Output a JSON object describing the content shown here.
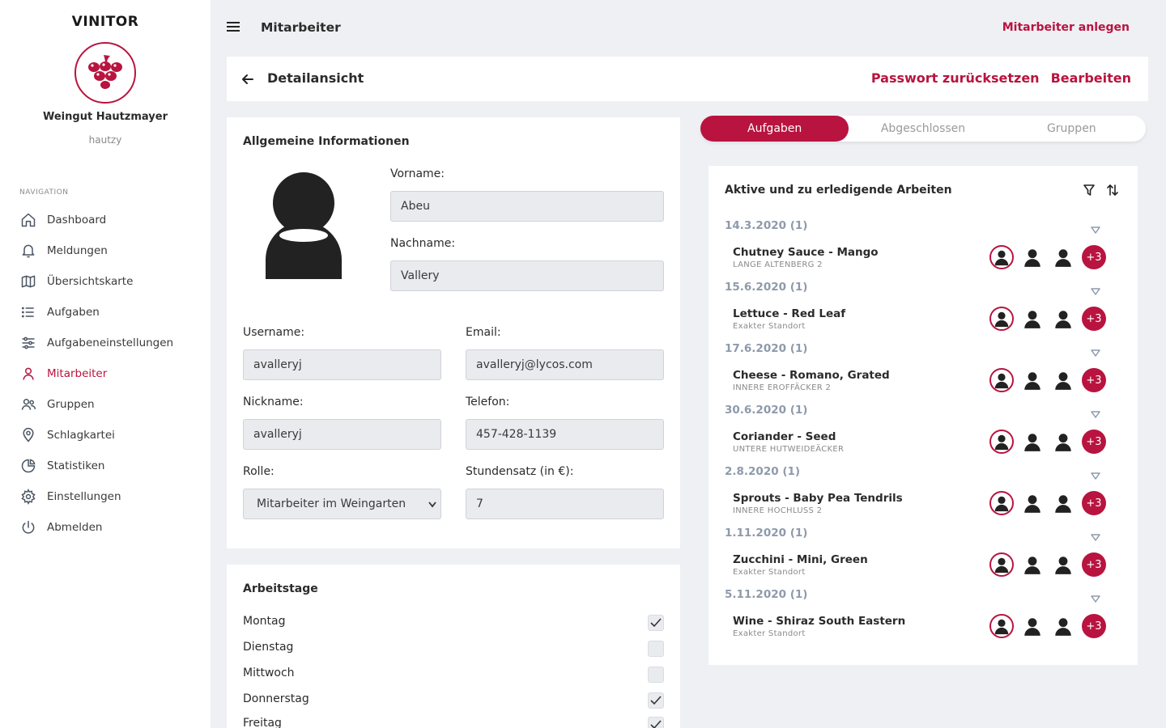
{
  "app": {
    "brand": "VINITOR",
    "org_name": "Weingut Hautzmayer",
    "org_user": "hautzy"
  },
  "colors": {
    "accent": "#b8143f",
    "background": "#eef0f4",
    "muted_date": "#8e9aab"
  },
  "sidebar": {
    "heading": "NAVIGATION",
    "items": [
      {
        "label": "Dashboard",
        "icon": "home-icon"
      },
      {
        "label": "Meldungen",
        "icon": "bell-icon"
      },
      {
        "label": "Übersichtskarte",
        "icon": "map-icon"
      },
      {
        "label": "Aufgaben",
        "icon": "list-icon"
      },
      {
        "label": "Aufgabeneinstellungen",
        "icon": "sliders-icon"
      },
      {
        "label": "Mitarbeiter",
        "icon": "user-icon",
        "active": true
      },
      {
        "label": "Gruppen",
        "icon": "users-icon"
      },
      {
        "label": "Schlagkartei",
        "icon": "map-pin-icon"
      },
      {
        "label": "Statistiken",
        "icon": "pie-chart-icon"
      },
      {
        "label": "Einstellungen",
        "icon": "gear-icon"
      },
      {
        "label": "Abmelden",
        "icon": "power-icon"
      }
    ]
  },
  "header": {
    "title": "Mitarbeiter",
    "create_label": "Mitarbeiter anlegen"
  },
  "detail": {
    "title": "Detailansicht",
    "reset_password_label": "Passwort zurücksetzen",
    "edit_label": "Bearbeiten"
  },
  "info": {
    "title": "Allgemeine Informationen",
    "firstname_label": "Vorname:",
    "firstname": "Abeu",
    "lastname_label": "Nachname:",
    "lastname": "Vallery",
    "username_label": "Username:",
    "username": "avalleryj",
    "email_label": "Email:",
    "email": "avalleryj@lycos.com",
    "nickname_label": "Nickname:",
    "nickname": "avalleryj",
    "phone_label": "Telefon:",
    "phone": "457-428-1139",
    "role_label": "Rolle:",
    "role": "Mitarbeiter im Weingarten",
    "rate_label": "Stundensatz (in €):",
    "rate": "7"
  },
  "workdays": {
    "title": "Arbeitstage",
    "days": [
      {
        "label": "Montag",
        "checked": true
      },
      {
        "label": "Dienstag",
        "checked": false
      },
      {
        "label": "Mittwoch",
        "checked": false
      },
      {
        "label": "Donnerstag",
        "checked": true
      },
      {
        "label": "Freitag",
        "checked": true
      }
    ]
  },
  "tabs": [
    {
      "label": "Aufgaben",
      "active": true
    },
    {
      "label": "Abgeschlossen",
      "active": false
    },
    {
      "label": "Gruppen",
      "active": false
    }
  ],
  "tasks": {
    "title": "Aktive und zu erledigende Arbeiten",
    "groups": [
      {
        "date": "14.3.2020 (1)",
        "name": "Chutney Sauce - Mango",
        "location": "LANGE ALTENBERG 2",
        "more": "+3"
      },
      {
        "date": "15.6.2020 (1)",
        "name": "Lettuce - Red Leaf",
        "location": "Exakter Standort",
        "more": "+3"
      },
      {
        "date": "17.6.2020 (1)",
        "name": "Cheese - Romano, Grated",
        "location": "INNERE EROFFÄCKER 2",
        "more": "+3"
      },
      {
        "date": "30.6.2020 (1)",
        "name": "Coriander - Seed",
        "location": "UNTERE HUTWEIDEÄCKER",
        "more": "+3"
      },
      {
        "date": "2.8.2020 (1)",
        "name": "Sprouts - Baby Pea Tendrils",
        "location": "INNERE HOCHLUSS 2",
        "more": "+3"
      },
      {
        "date": "1.11.2020 (1)",
        "name": "Zucchini - Mini, Green",
        "location": "Exakter Standort",
        "more": "+3"
      },
      {
        "date": "5.11.2020 (1)",
        "name": "Wine - Shiraz South Eastern",
        "location": "Exakter Standort",
        "more": "+3"
      }
    ]
  }
}
